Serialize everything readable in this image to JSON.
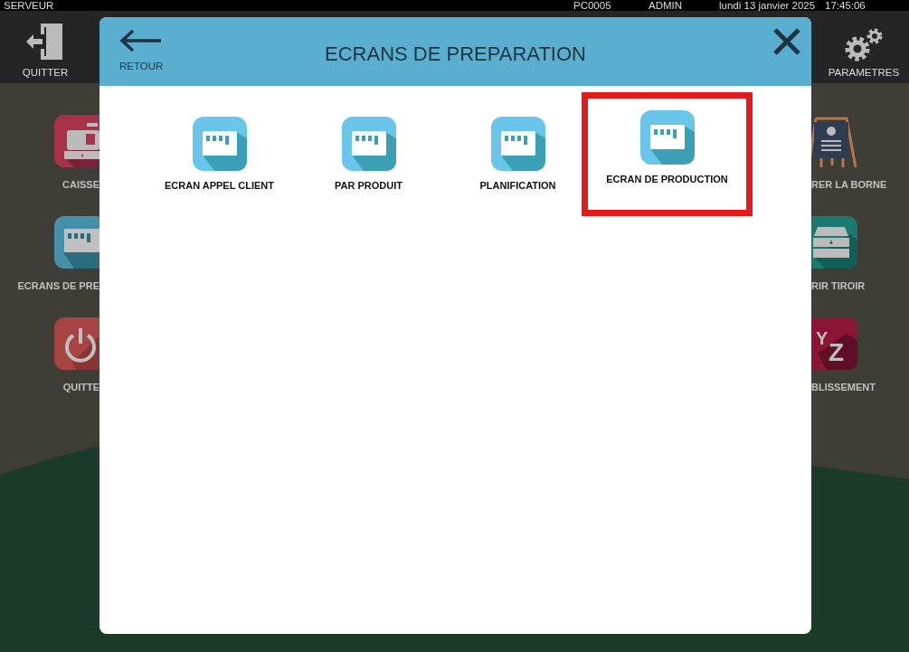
{
  "status_bar": {
    "app": "SERVEUR",
    "station": "PC0005",
    "user": "ADMIN",
    "date": "lundi 13 janvier 2025",
    "time": "17:45:06"
  },
  "toolbar": [
    {
      "kind": "quit",
      "label": "QUITTER"
    },
    {
      "kind": "settings",
      "label": "PARAMETRES"
    }
  ],
  "background_tiles": {
    "left": [
      {
        "kind": "register",
        "label": "CAISSE"
      },
      {
        "kind": "screens",
        "label": "ECRANS DE PRE"
      },
      {
        "kind": "power",
        "label": "QUITTE"
      }
    ],
    "right": [
      {
        "kind": "easel",
        "label": "RER LA BORNE"
      },
      {
        "kind": "drawer",
        "label": "RIR TIROIR"
      },
      {
        "kind": "letters",
        "label": "BLISSEMENT",
        "glyphs": [
          "Y",
          "Z"
        ]
      }
    ]
  },
  "dialog": {
    "title": "ECRANS DE PREPARATION",
    "back_label": "RETOUR",
    "items": [
      {
        "label": "ECRAN APPEL CLIENT",
        "highlighted": false
      },
      {
        "label": "PAR PRODUIT",
        "highlighted": false
      },
      {
        "label": "PLANIFICATION",
        "highlighted": false
      },
      {
        "label": "ECRAN DE PRODUCTION",
        "highlighted": true
      }
    ]
  }
}
